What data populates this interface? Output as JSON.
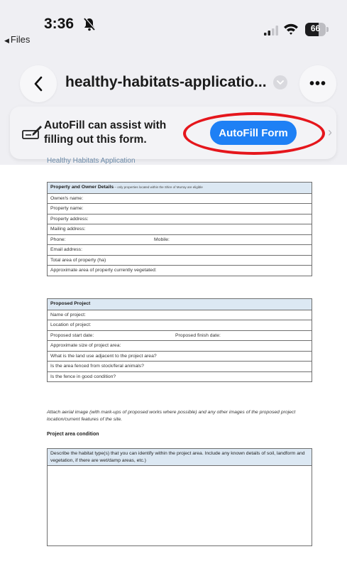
{
  "status_bar": {
    "time": "3:36",
    "back_app": "Files",
    "battery_level": "66",
    "battery_fraction": 0.66
  },
  "nav": {
    "title": "healthy-habitats-applicatio...",
    "more_label": "•••"
  },
  "autofill": {
    "message": "AutoFill can assist with filling out this form.",
    "button_label": "AutoFill Form",
    "highlight_color": "#e5161c",
    "button_color": "#1e80f5"
  },
  "document": {
    "heading": "Healthy Habitats Application",
    "table1": {
      "header": "Property and Owner Details",
      "header_note": " – only properties located within the Shire of Murray are eligible",
      "rows": [
        "Owner/s name:",
        "Property name:",
        "Property address:",
        "Mailing address:",
        "Phone:",
        "Email address:",
        "Total area of property (ha)",
        "Approximate area of property currently vegetated:"
      ],
      "phone_right": "Mobile:"
    },
    "table2": {
      "header": "Proposed Project",
      "rows": [
        "Name of project:",
        "Location of project:",
        "Proposed start date:",
        "Approximate size of project area:",
        "What is the land use adjacent to the project area?",
        "Is the area fenced from stock/feral animals?",
        "Is the fence in good condition?"
      ],
      "start_right": "Proposed finish date:"
    },
    "attach_note": "Attach aerial image (with mark-ups of proposed works where possible) and any other images of the proposed project location/current features of the site.",
    "condition_title": "Project area condition",
    "condition_prompt": "Describe the habitat type(s) that you can identify within the project area. Include any known details of soil, landform and vegetation, if there are wet/damp areas, etc.)"
  },
  "icons": {
    "bell": "bell-slash-icon",
    "signal": "cellular-signal-icon",
    "wifi": "wifi-icon",
    "back": "chevron-left-icon",
    "title_menu": "chevron-down-icon",
    "more": "ellipsis-icon",
    "autofill": "pencil-form-icon"
  }
}
